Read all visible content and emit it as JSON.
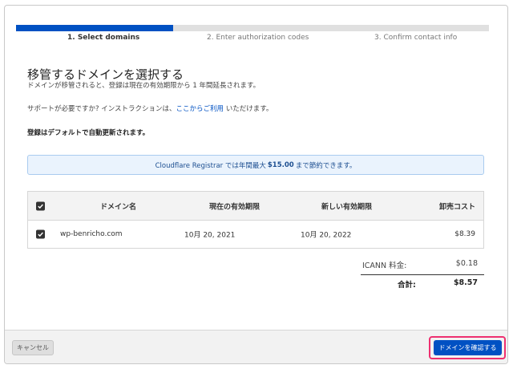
{
  "steps": [
    {
      "label": "1. Select domains",
      "active": true
    },
    {
      "label": "2. Enter authorization codes",
      "active": false
    },
    {
      "label": "3. Confirm contact info",
      "active": false
    }
  ],
  "stepper": {
    "progress": 0.333
  },
  "page": {
    "title": "移管するドメインを選択する",
    "subtitle": "ドメインが移管されると、登録は現在の有効期限から 1 年間延長されます。",
    "support_prefix": "サポートが必要ですか? インストラクションは、",
    "support_link": "ここからご利用",
    "support_suffix": " いただけます。",
    "autorenew": "登録はデフォルトで自動更新されます。"
  },
  "banner": {
    "prefix": "Cloudflare Registrar では年間最大",
    "amount": "$15.00",
    "suffix": "まで節約できます。"
  },
  "table": {
    "headers": {
      "domain": "ドメイン名",
      "current_expiry": "現在の有効期限",
      "new_expiry": "新しい有効期限",
      "wholesale_cost": "卸売コスト"
    },
    "rows": [
      {
        "domain": "wp-benricho.com",
        "current_expiry": "10月 20, 2021",
        "new_expiry": "10月 20, 2022",
        "cost": "$8.39",
        "checked": true
      }
    ]
  },
  "summary": {
    "icann_label": "ICANN 料金:",
    "icann_value": "$0.18",
    "total_label": "合計:",
    "total_value": "$8.57"
  },
  "footer": {
    "cancel_label": "キャンセル",
    "confirm_label": "ドメインを確認する"
  },
  "colors": {
    "accent": "#0051c3",
    "highlight": "#ee3070",
    "banner_bg": "#eaf3fd"
  }
}
